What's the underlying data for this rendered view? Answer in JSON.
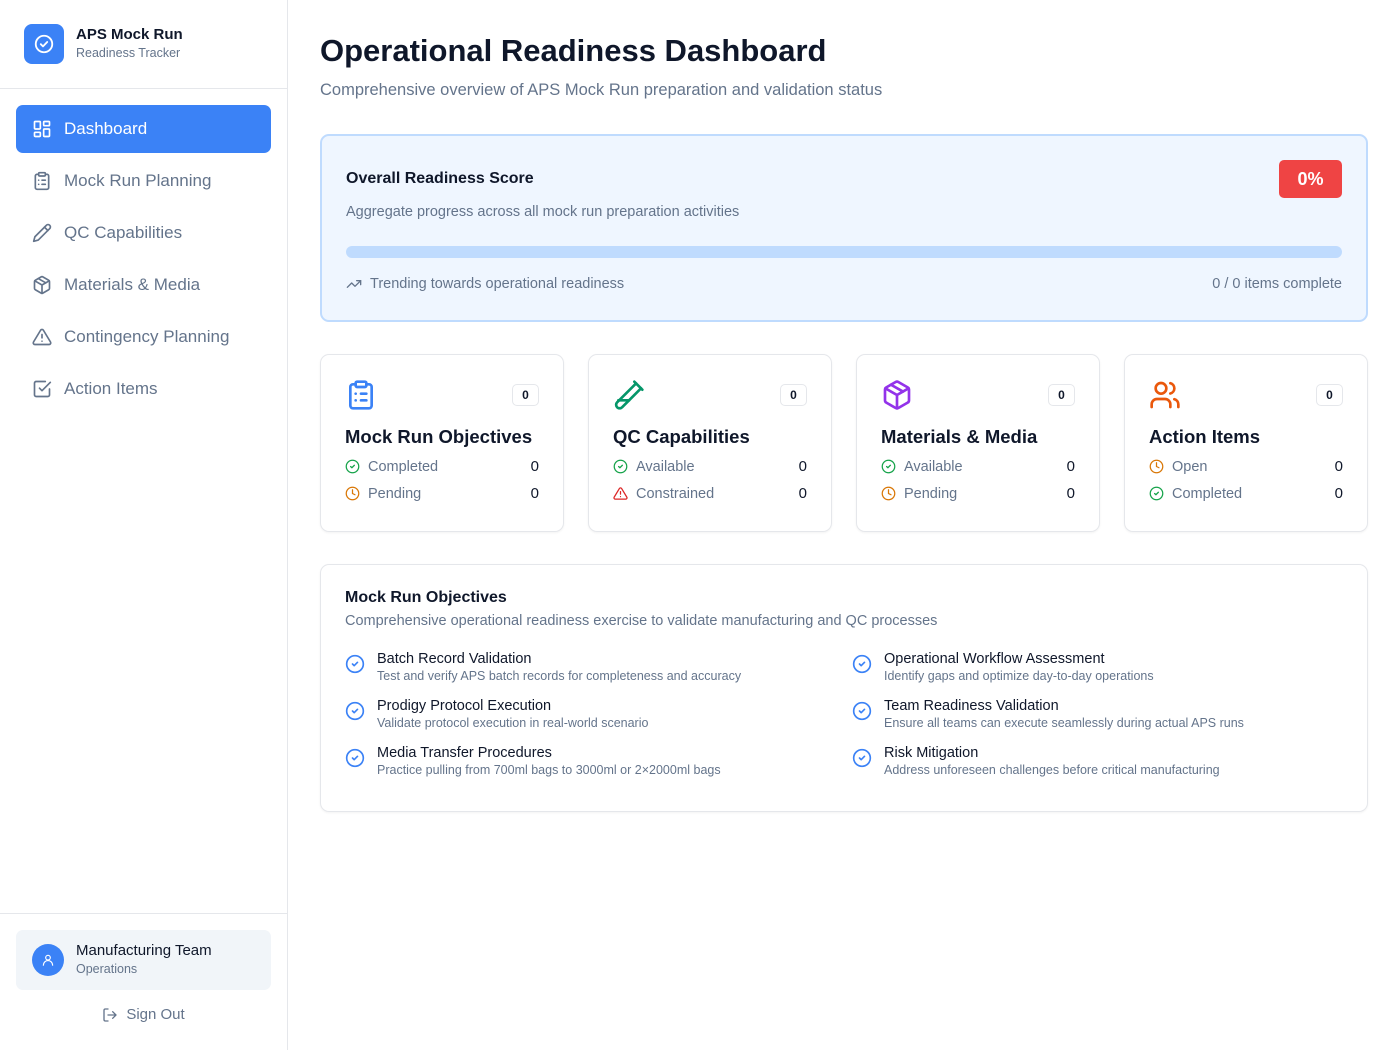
{
  "brand": {
    "title": "APS Mock Run",
    "subtitle": "Readiness Tracker",
    "icon": "check-circle-icon",
    "color": "#3b82f6"
  },
  "nav": {
    "items": [
      {
        "label": "Dashboard",
        "icon": "layout-grid-icon",
        "active": true
      },
      {
        "label": "Mock Run Planning",
        "icon": "clipboard-list-icon",
        "active": false
      },
      {
        "label": "QC Capabilities",
        "icon": "pencil-icon",
        "active": false
      },
      {
        "label": "Materials & Media",
        "icon": "package-icon",
        "active": false
      },
      {
        "label": "Contingency Planning",
        "icon": "alert-triangle-icon",
        "active": false
      },
      {
        "label": "Action Items",
        "icon": "check-square-icon",
        "active": false
      }
    ]
  },
  "user": {
    "name": "Manufacturing Team",
    "role": "Operations",
    "sign_out": "Sign Out"
  },
  "header": {
    "title": "Operational Readiness Dashboard",
    "subtitle": "Comprehensive overview of APS Mock Run preparation and validation status"
  },
  "score": {
    "title": "Overall Readiness Score",
    "description": "Aggregate progress across all mock run preparation activities",
    "badge": "0%",
    "progress_fraction": 0,
    "trend": "Trending towards operational readiness",
    "items_complete": "0 / 0 items complete"
  },
  "cards": [
    {
      "title": "Mock Run Objectives",
      "icon": "clipboard-list-icon",
      "icon_color": "#3b82f6",
      "count": "0",
      "rows": [
        {
          "label": "Completed",
          "value": "0",
          "status": "check"
        },
        {
          "label": "Pending",
          "value": "0",
          "status": "clock"
        }
      ]
    },
    {
      "title": "QC Capabilities",
      "icon": "test-tube-icon",
      "icon_color": "#059669",
      "count": "0",
      "rows": [
        {
          "label": "Available",
          "value": "0",
          "status": "check"
        },
        {
          "label": "Constrained",
          "value": "0",
          "status": "warning"
        }
      ]
    },
    {
      "title": "Materials & Media",
      "icon": "package-icon",
      "icon_color": "#9333ea",
      "count": "0",
      "rows": [
        {
          "label": "Available",
          "value": "0",
          "status": "check"
        },
        {
          "label": "Pending",
          "value": "0",
          "status": "clock"
        }
      ]
    },
    {
      "title": "Action Items",
      "icon": "users-icon",
      "icon_color": "#ea580c",
      "count": "0",
      "rows": [
        {
          "label": "Open",
          "value": "0",
          "status": "clock"
        },
        {
          "label": "Completed",
          "value": "0",
          "status": "check"
        }
      ]
    }
  ],
  "objectives": {
    "title": "Mock Run Objectives",
    "subtitle": "Comprehensive operational readiness exercise to validate manufacturing and QC processes",
    "items": [
      {
        "name": "Batch Record Validation",
        "desc": "Test and verify APS batch records for completeness and accuracy"
      },
      {
        "name": "Operational Workflow Assessment",
        "desc": "Identify gaps and optimize day-to-day operations"
      },
      {
        "name": "Prodigy Protocol Execution",
        "desc": "Validate protocol execution in real-world scenario"
      },
      {
        "name": "Team Readiness Validation",
        "desc": "Ensure all teams can execute seamlessly during actual APS runs"
      },
      {
        "name": "Media Transfer Procedures",
        "desc": "Practice pulling from 700ml bags to 3000ml or 2×2000ml bags"
      },
      {
        "name": "Risk Mitigation",
        "desc": "Address unforeseen challenges before critical manufacturing"
      }
    ]
  }
}
